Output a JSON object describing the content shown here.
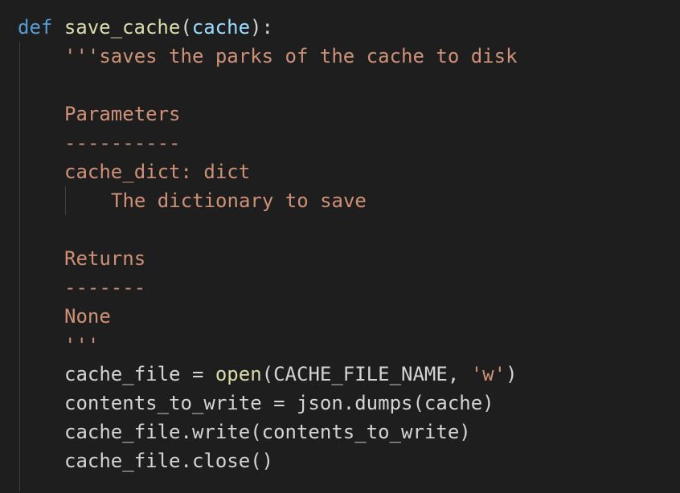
{
  "code": {
    "l1": {
      "kw": "def",
      "space": " ",
      "fn": "save_cache",
      "open": "(",
      "param": "cache",
      "close": "):"
    },
    "l2": "'''saves the parks of the cache to disk",
    "l4": "Parameters",
    "l5": "----------",
    "l6": "cache_dict: dict",
    "l7": "The dictionary to save",
    "l9": "Returns",
    "l10": "-------",
    "l11": "None",
    "l12": "'''",
    "l13": {
      "a": "cache_file = ",
      "fn": "open",
      "b": "(CACHE_FILE_NAME, ",
      "str": "'w'",
      "c": ")"
    },
    "l14": "contents_to_write = json.dumps(cache)",
    "l15": "cache_file.write(contents_to_write)",
    "l16": "cache_file.close()"
  },
  "colors": {
    "background": "#1e1e1e",
    "keyword": "#569cd6",
    "function": "#dcdcaa",
    "parameter": "#9cdcfe",
    "text": "#d4d4d4",
    "string": "#ce9178"
  }
}
